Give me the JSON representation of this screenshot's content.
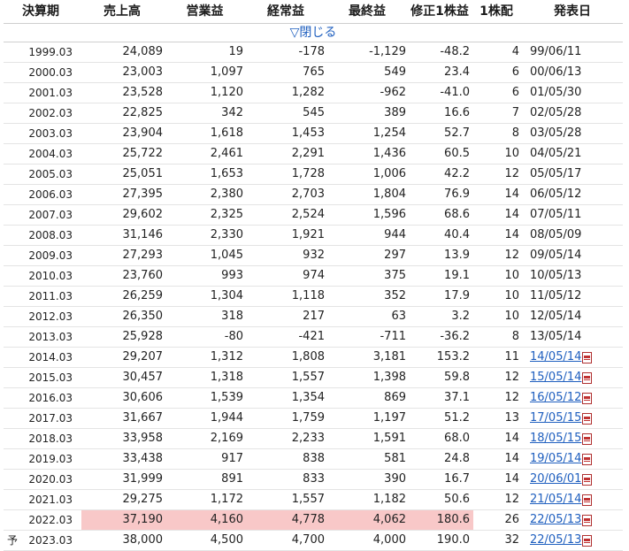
{
  "table": {
    "headers": [
      "決算期",
      "売上高",
      "営業益",
      "経常益",
      "最終益",
      "修正1株益",
      "1株配",
      "発表日"
    ],
    "toggle_label": "▽閉じる",
    "prediction_mark": "予",
    "highlight_color": "#f8c8c8",
    "link_color": "#1f5fbf",
    "rows": [
      {
        "period": "1999.03",
        "sales": "24,089",
        "op": "19",
        "ord": "-178",
        "net": "-1,129",
        "eps": "-48.2",
        "div": "4",
        "date": "99/06/11"
      },
      {
        "period": "2000.03",
        "sales": "23,003",
        "op": "1,097",
        "ord": "765",
        "net": "549",
        "eps": "23.4",
        "div": "6",
        "date": "00/06/13"
      },
      {
        "period": "2001.03",
        "sales": "23,528",
        "op": "1,120",
        "ord": "1,282",
        "net": "-962",
        "eps": "-41.0",
        "div": "6",
        "date": "01/05/30"
      },
      {
        "period": "2002.03",
        "sales": "22,825",
        "op": "342",
        "ord": "545",
        "net": "389",
        "eps": "16.6",
        "div": "7",
        "date": "02/05/28"
      },
      {
        "period": "2003.03",
        "sales": "23,904",
        "op": "1,618",
        "ord": "1,453",
        "net": "1,254",
        "eps": "52.7",
        "div": "8",
        "date": "03/05/28"
      },
      {
        "period": "2004.03",
        "sales": "25,722",
        "op": "2,461",
        "ord": "2,291",
        "net": "1,436",
        "eps": "60.5",
        "div": "10",
        "date": "04/05/21"
      },
      {
        "period": "2005.03",
        "sales": "25,051",
        "op": "1,653",
        "ord": "1,728",
        "net": "1,006",
        "eps": "42.2",
        "div": "12",
        "date": "05/05/17"
      },
      {
        "period": "2006.03",
        "sales": "27,395",
        "op": "2,380",
        "ord": "2,703",
        "net": "1,804",
        "eps": "76.9",
        "div": "14",
        "date": "06/05/12"
      },
      {
        "period": "2007.03",
        "sales": "29,602",
        "op": "2,325",
        "ord": "2,524",
        "net": "1,596",
        "eps": "68.6",
        "div": "14",
        "date": "07/05/11"
      },
      {
        "period": "2008.03",
        "sales": "31,146",
        "op": "2,330",
        "ord": "1,921",
        "net": "944",
        "eps": "40.4",
        "div": "14",
        "date": "08/05/09"
      },
      {
        "period": "2009.03",
        "sales": "27,293",
        "op": "1,045",
        "ord": "932",
        "net": "297",
        "eps": "13.9",
        "div": "12",
        "date": "09/05/14"
      },
      {
        "period": "2010.03",
        "sales": "23,760",
        "op": "993",
        "ord": "974",
        "net": "375",
        "eps": "19.1",
        "div": "10",
        "date": "10/05/13"
      },
      {
        "period": "2011.03",
        "sales": "26,259",
        "op": "1,304",
        "ord": "1,118",
        "net": "352",
        "eps": "17.9",
        "div": "10",
        "date": "11/05/12"
      },
      {
        "period": "2012.03",
        "sales": "26,350",
        "op": "318",
        "ord": "217",
        "net": "63",
        "eps": "3.2",
        "div": "10",
        "date": "12/05/14"
      },
      {
        "period": "2013.03",
        "sales": "25,928",
        "op": "-80",
        "ord": "-421",
        "net": "-711",
        "eps": "-36.2",
        "div": "8",
        "date": "13/05/14"
      },
      {
        "period": "2014.03",
        "sales": "29,207",
        "op": "1,312",
        "ord": "1,808",
        "net": "3,181",
        "eps": "153.2",
        "div": "11",
        "date": "14/05/14",
        "link": true
      },
      {
        "period": "2015.03",
        "sales": "30,457",
        "op": "1,318",
        "ord": "1,557",
        "net": "1,398",
        "eps": "59.8",
        "div": "12",
        "date": "15/05/14",
        "link": true
      },
      {
        "period": "2016.03",
        "sales": "30,606",
        "op": "1,539",
        "ord": "1,354",
        "net": "869",
        "eps": "37.1",
        "div": "12",
        "date": "16/05/12",
        "link": true
      },
      {
        "period": "2017.03",
        "sales": "31,667",
        "op": "1,944",
        "ord": "1,759",
        "net": "1,197",
        "eps": "51.2",
        "div": "13",
        "date": "17/05/15",
        "link": true
      },
      {
        "period": "2018.03",
        "sales": "33,958",
        "op": "2,169",
        "ord": "2,233",
        "net": "1,591",
        "eps": "68.0",
        "div": "14",
        "date": "18/05/15",
        "link": true
      },
      {
        "period": "2019.03",
        "sales": "33,438",
        "op": "917",
        "ord": "838",
        "net": "581",
        "eps": "24.8",
        "div": "14",
        "date": "19/05/14",
        "link": true
      },
      {
        "period": "2020.03",
        "sales": "31,999",
        "op": "891",
        "ord": "833",
        "net": "390",
        "eps": "16.7",
        "div": "14",
        "date": "20/06/01",
        "link": true
      },
      {
        "period": "2021.03",
        "sales": "29,275",
        "op": "1,172",
        "ord": "1,557",
        "net": "1,182",
        "eps": "50.6",
        "div": "12",
        "date": "21/05/14",
        "link": true
      },
      {
        "period": "2022.03",
        "sales": "37,190",
        "op": "4,160",
        "ord": "4,778",
        "net": "4,062",
        "eps": "180.6",
        "div": "26",
        "date": "22/05/13",
        "link": true,
        "highlight": true
      },
      {
        "period": "2023.03",
        "sales": "38,000",
        "op": "4,500",
        "ord": "4,700",
        "net": "4,000",
        "eps": "190.0",
        "div": "32",
        "date": "22/05/13",
        "link": true,
        "prediction": true
      }
    ]
  }
}
